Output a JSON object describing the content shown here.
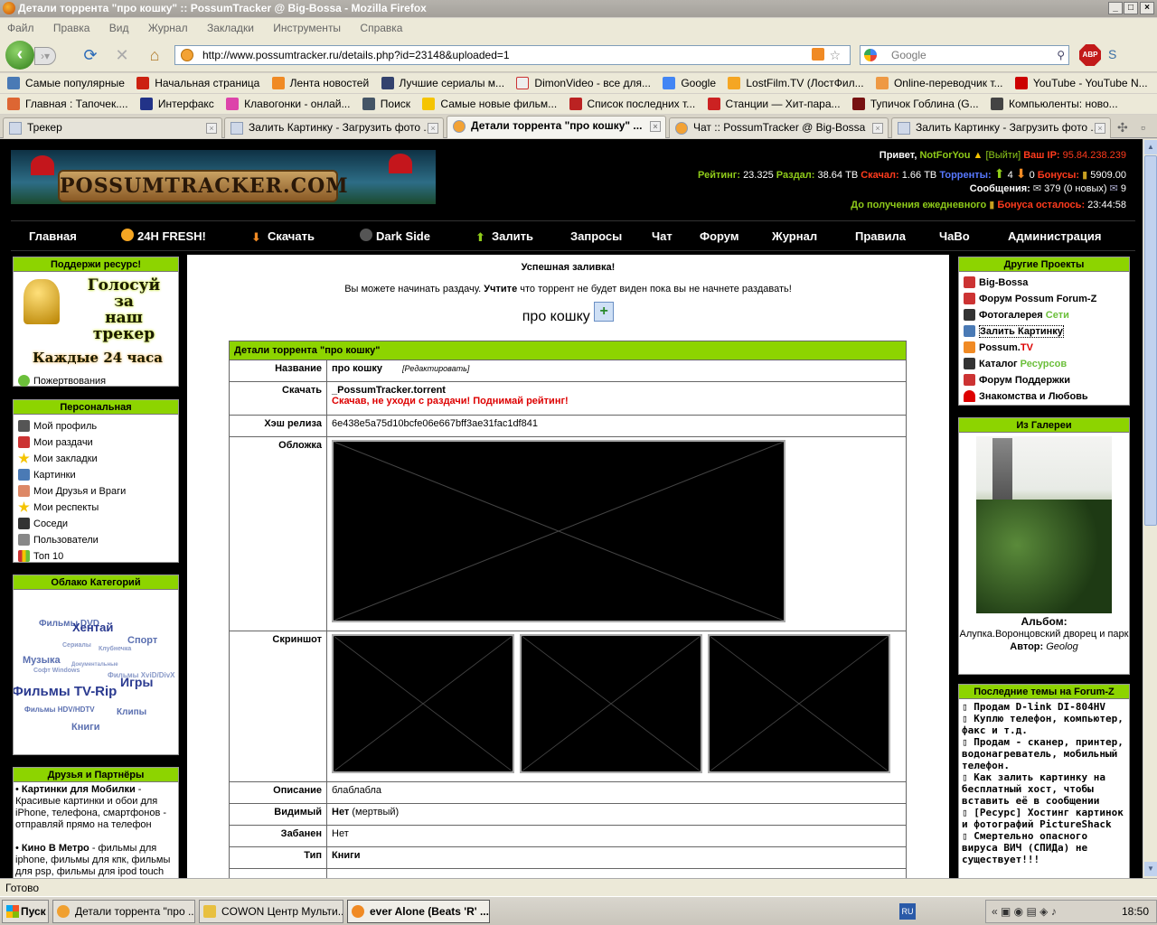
{
  "window": {
    "title": "Детали торрента \"про кошку\" :: PossumTracker @ Big-Bossa - Mozilla Firefox"
  },
  "menubar": [
    "Файл",
    "Правка",
    "Вид",
    "Журнал",
    "Закладки",
    "Инструменты",
    "Справка"
  ],
  "url": "http://www.possumtracker.ru/details.php?id=23148&uploaded=1",
  "search_placeholder": "Google",
  "abp_label": "ABP",
  "bookmarks_row1": [
    "Самые популярные",
    "Начальная страница",
    "Лента новостей",
    "Лучшие сериалы м...",
    "DimonVideo - все для...",
    "Google",
    "LostFilm.TV (ЛостФил...",
    "Online-переводчик т...",
    "YouTube - YouTube N..."
  ],
  "bookmarks_row2": [
    "Главная : Тапочек....",
    "Интерфакс",
    "Клавогонки - онлай...",
    "Поиск",
    "Самые новые фильм...",
    "Список последних т...",
    "Станции — Хит-пара...",
    "Тупичок Гоблина (G...",
    "Компьюленты: ново..."
  ],
  "tabs": [
    "Трекер",
    "Залить Картинку - Загрузить фото ...",
    "Детали торрента \"про кошку\" ...",
    "Чат :: PossumTracker @ Big-Bossa",
    "Залить Картинку - Загрузить фото ..."
  ],
  "site": {
    "logo_text": "POSSUMTRACKER.COM",
    "greeting": "Привет,",
    "username": "NotForYou",
    "logout": "[Выйти]",
    "ip_label": "Ваш IP:",
    "ip": "95.84.238.239",
    "rating_label": "Рейтинг:",
    "rating": "23.325",
    "upload_label": "Раздал:",
    "upload": "38.64 TB",
    "download_label": "Скачал:",
    "download": "1.66 TB",
    "torrents_label": "Торренты:",
    "seeding": "4",
    "leeching": "0",
    "bonus_label": "Бонусы:",
    "bonus": "5909.00",
    "messages_label": "Сообщения:",
    "messages": "379 (0 новых)",
    "sent": "9",
    "daily_label": "До получения ежедневного",
    "daily_bonus": "Бонуса осталось:",
    "daily_time": "23:44:58"
  },
  "site_menu": [
    "Главная",
    "24H FRESH!",
    "Скачать",
    "Dark Side",
    "Залить",
    "Запросы",
    "Чат",
    "Форум",
    "Журнал",
    "Правила",
    "ЧаВо",
    "Администрация"
  ],
  "left": {
    "support_title": "Поддержи ресурс!",
    "support_banner": [
      "Голосуй",
      "за",
      "наш трекер",
      "Каждые 24 часа"
    ],
    "donate": "Пожертвования",
    "personal_title": "Персональная",
    "personal_items": [
      "Мой профиль",
      "Мои раздачи",
      "Мои закладки",
      "Картинки",
      "Мои Друзья и Враги",
      "Мои респекты",
      "Соседи",
      "Пользователи",
      "Топ 10"
    ],
    "cloud_title": "Облако Категорий",
    "cloud": [
      {
        "t": "Фильмы DVD",
        "s": 10
      },
      {
        "t": "Хентай",
        "s": 13
      },
      {
        "t": "Спорт",
        "s": 11
      },
      {
        "t": "Сериалы",
        "s": 8
      },
      {
        "t": "Клубнечка",
        "s": 7
      },
      {
        "t": "Музыка",
        "s": 11
      },
      {
        "t": "Документальные",
        "s": 6
      },
      {
        "t": "Софт Windows",
        "s": 7
      },
      {
        "t": "Фильмы XviD/DivX",
        "s": 8
      },
      {
        "t": "Игры",
        "s": 14
      },
      {
        "t": "Фильмы TV-Rip",
        "s": 15
      },
      {
        "t": "Фильмы HDV/HDTV",
        "s": 8
      },
      {
        "t": "Клипы",
        "s": 10
      },
      {
        "t": "Книги",
        "s": 11
      }
    ],
    "friends_title": "Друзья и Партнёры",
    "friends": [
      {
        "name": "Картинки для Мобилки",
        "desc": " - Красивые картинки и обои для iPhone, телефона, смартфонов - отправляй прямо на телефон"
      },
      {
        "name": "Кино В Метро",
        "desc": " - фильмы для iphone, фильмы для кпк, фильмы для psp, фильмы для ipod touch"
      }
    ]
  },
  "main": {
    "success": "Успешная заливка!",
    "msg_pre": "Вы можете начинать раздачу. ",
    "msg_bold": "Учтите",
    "msg_post": " что торрент не будет виден пока вы не начнете раздавать!",
    "torrent_title": "про кошку",
    "table_title": "Детали торрента \"про кошку\"",
    "rows": {
      "name_label": "Название",
      "name": "про кошку",
      "edit": "[Редактировать]",
      "dl_label": "Скачать",
      "dl_file": "_PossumTracker.torrent",
      "dl_warn": "Скачав, не уходи с раздачи! Поднимай рейтинг!",
      "hash_label": "Хэш релиза",
      "hash": "6e438e5a75d10bcfe06e667bff3ae31fac1df841",
      "cover_label": "Обложка",
      "shots_label": "Скриншот",
      "desc_label": "Описание",
      "desc": "блаблабла",
      "visible_label": "Видимый",
      "visible": "Нет",
      "visible_note": " (мертвый)",
      "banned_label": "Забанен",
      "banned": "Нет",
      "type_label": "Тип",
      "type": "Книги"
    }
  },
  "right": {
    "projects_title": "Другие Проекты",
    "projects": [
      {
        "a": "Big-Bossa",
        "b": ""
      },
      {
        "a": "Форум Possum Forum-Z",
        "b": ""
      },
      {
        "a": "Фотогалерея ",
        "b": "Сети"
      },
      {
        "a": "Залить Картинку",
        "b": ""
      },
      {
        "a": "Possum.",
        "b": "TV"
      },
      {
        "a": "Каталог ",
        "b": "Ресурсов"
      },
      {
        "a": "Форум Поддержки",
        "b": ""
      },
      {
        "a": "Знакомства и Любовь",
        "b": ""
      }
    ],
    "gallery_title": "Из Галереи",
    "album_label": "Альбом:",
    "album": "Алупка.Воронцовский дворец и парк",
    "author_label": "Автор:",
    "author": "Geolog",
    "forum_title": "Последние темы на Forum-Z",
    "forum_items": [
      "Продам D-link DI-804HV",
      "Куплю телефон, компьютер, факс и т.д.",
      "Продам - сканер, принтер, водонагреватель, мобильный телефон.",
      "Как залить картинку на бесплатный хост, чтобы вставить её в сообщении",
      "[Ресурс] Хостинг картинок и фотографий PictureShack",
      "Смертельно опасного вируса ВИЧ (СПИДа) не существует!!!"
    ]
  },
  "status": "Готово",
  "taskbar": {
    "start": "Пуск",
    "tasks": [
      "Детали торрента \"про ...",
      "COWON Центр Мульти...",
      "ever Alone (Beats 'R' ..."
    ],
    "lang": "RU",
    "clock": "18:50"
  }
}
